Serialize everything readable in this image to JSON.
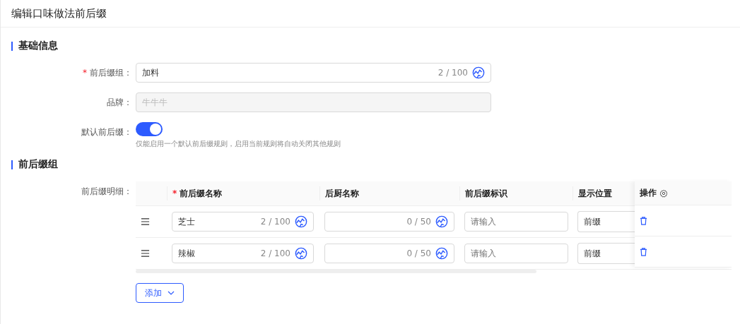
{
  "page": {
    "title": "编辑口味做法前后缀"
  },
  "basic": {
    "title": "基础信息",
    "fields": [
      {
        "kind": "text",
        "label": "前后缀组：",
        "required_mark": "*",
        "value": "加料",
        "counter": "2 / 100",
        "disabled": false
      },
      {
        "kind": "text",
        "label": "品牌：",
        "value": "牛牛牛",
        "disabled": true
      },
      {
        "kind": "switch",
        "label": "默认前后缀：",
        "on": true,
        "hint": "仅能启用一个默认前后缀规则，启用当前规则将自动关闭其他规则"
      }
    ]
  },
  "group": {
    "title": "前后缀组",
    "label": "前后缀明细：",
    "columns": [
      {
        "label": "前后缀名称",
        "required_mark": "*"
      },
      {
        "label": "后厨名称"
      },
      {
        "label": "前后缀标识"
      },
      {
        "label": "显示位置"
      },
      {
        "label": "操作"
      }
    ],
    "rows": [
      {
        "name": "芝士",
        "name_counter": "2 / 100",
        "kitchen_counter": "0 / 50",
        "ident_placeholder": "请输入",
        "position": "前缀"
      },
      {
        "name": "辣椒",
        "name_counter": "2 / 100",
        "kitchen_counter": "0 / 50",
        "ident_placeholder": "请输入",
        "position": "前缀"
      }
    ],
    "add_button": "添加"
  }
}
